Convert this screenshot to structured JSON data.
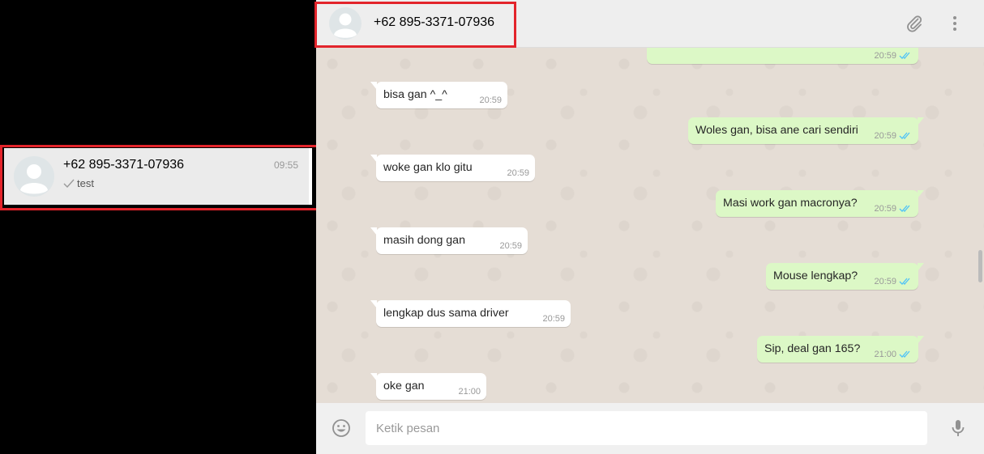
{
  "sidebar": {
    "chat": {
      "name": "+62 895-3371-07936",
      "time": "09:55",
      "preview": "test",
      "preview_icon": "single-check-icon"
    }
  },
  "header": {
    "title": "+62 895-3371-07936",
    "icons": [
      "default-avatar-icon",
      "paperclip-icon",
      "menu-dots-icon"
    ]
  },
  "messages": [
    {
      "dir": "out",
      "text": "",
      "time": "20:59",
      "status": "read"
    },
    {
      "dir": "in",
      "text": "bisa gan ^_^",
      "time": "20:59"
    },
    {
      "dir": "out",
      "text": "Woles gan, bisa ane cari sendiri",
      "time": "20:59",
      "status": "read"
    },
    {
      "dir": "in",
      "text": "woke gan klo gitu",
      "time": "20:59"
    },
    {
      "dir": "out",
      "text": "Masi work gan macronya?",
      "time": "20:59",
      "status": "read"
    },
    {
      "dir": "in",
      "text": "masih dong gan",
      "time": "20:59"
    },
    {
      "dir": "out",
      "text": "Mouse lengkap?",
      "time": "20:59",
      "status": "read"
    },
    {
      "dir": "in",
      "text": "lengkap dus sama driver",
      "time": "20:59"
    },
    {
      "dir": "out",
      "text": "Sip, deal gan 165?",
      "time": "21:00",
      "status": "read"
    },
    {
      "dir": "in",
      "text": "oke gan",
      "time": "21:00"
    }
  ],
  "footer": {
    "placeholder": "Ketik pesan",
    "icons": [
      "emoji-icon",
      "microphone-icon"
    ]
  },
  "colors": {
    "incoming_bubble": "#ffffff",
    "outgoing_bubble": "#dcf8c6",
    "chat_background": "#e5ddd5",
    "read_ticks": "#4fc3f7",
    "highlight_box": "#e3242b"
  }
}
